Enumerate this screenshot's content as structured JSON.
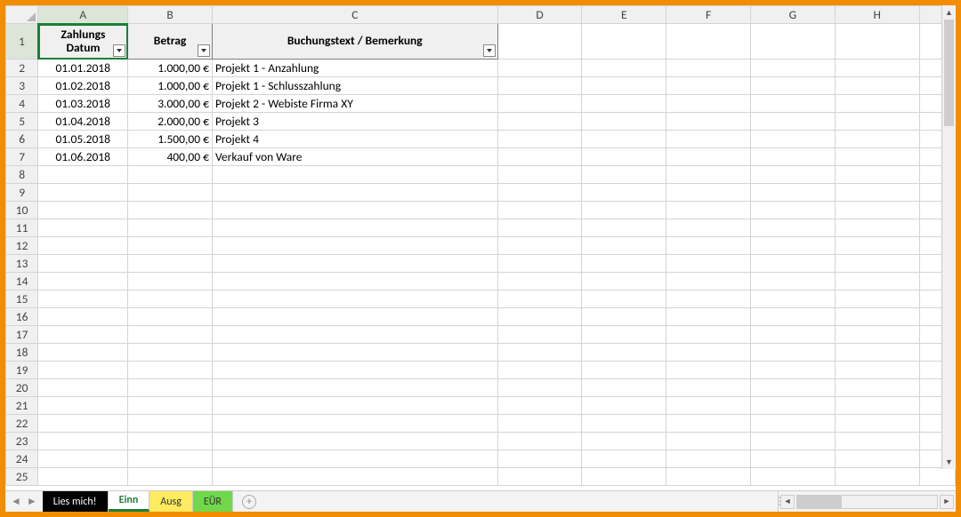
{
  "columns": [
    "A",
    "B",
    "C",
    "D",
    "E",
    "F",
    "G",
    "H"
  ],
  "active_cell": "A1",
  "headers": {
    "A": "Zahlungs\nDatum",
    "B": "Betrag",
    "C": "Buchungstext / Bemerkung"
  },
  "rows": [
    {
      "num": 2,
      "date": "01.01.2018",
      "amount": "1.000,00 €",
      "text": "Projekt 1 - Anzahlung"
    },
    {
      "num": 3,
      "date": "01.02.2018",
      "amount": "1.000,00 €",
      "text": "Projekt 1 - Schlusszahlung"
    },
    {
      "num": 4,
      "date": "01.03.2018",
      "amount": "3.000,00 €",
      "text": "Projekt 2 - Webiste Firma XY"
    },
    {
      "num": 5,
      "date": "01.04.2018",
      "amount": "2.000,00 €",
      "text": "Projekt 3"
    },
    {
      "num": 6,
      "date": "01.05.2018",
      "amount": "1.500,00 €",
      "text": "Projekt 4"
    },
    {
      "num": 7,
      "date": "01.06.2018",
      "amount": "400,00 €",
      "text": "Verkauf von Ware"
    }
  ],
  "empty_row_start": 8,
  "empty_row_end": 25,
  "tabs": [
    {
      "label": "Lies mich!",
      "style": "black"
    },
    {
      "label": "Einn",
      "style": "green",
      "active": true
    },
    {
      "label": "Ausg",
      "style": "yellow"
    },
    {
      "label": "EÜR",
      "style": "lime"
    }
  ],
  "icons": {
    "add": "+",
    "left": "◄",
    "right": "►",
    "up": "▲",
    "down": "▼",
    "dots": "⋮"
  }
}
